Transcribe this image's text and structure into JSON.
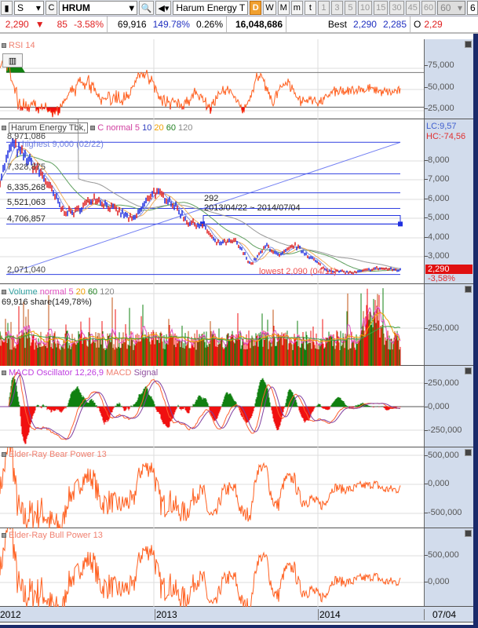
{
  "toolbar": {
    "type": "S",
    "c": "C",
    "symbol": "HRUM",
    "name": "Harum Energy T",
    "periods": [
      "D",
      "W",
      "M",
      "m",
      "t"
    ],
    "active_period": "D",
    "minutes": [
      "1",
      "3",
      "5",
      "10",
      "15",
      "30",
      "45",
      "60"
    ],
    "minute_select": "60",
    "extra": "6"
  },
  "quote": {
    "price": "2,290",
    "change": "85",
    "change_pct": "-3.58%",
    "volume": "69,916",
    "vol_ratio": "149.78%",
    "turnover": "0.26%",
    "amount": "16,048,686",
    "best_label": "Best",
    "bid": "2,290",
    "ask": "2,285",
    "open_label": "O",
    "open": "2,29"
  },
  "rsi": {
    "title": "RSI 14",
    "ticks": [
      "75,000",
      "50,000",
      "25,000"
    ]
  },
  "price": {
    "title": "Harum Energy Tbk,",
    "ma_label": "C normal 5",
    "ma": [
      "10",
      "20",
      "60",
      "120"
    ],
    "lc": "LC:9,57",
    "hc": "HC:-74,56",
    "highest": "highest 9,000 (02/22)",
    "lowest": "lowest 2,090 (04/11)",
    "levels": [
      "8,971,086",
      "7,328,875",
      "6,335,268",
      "5,521,063",
      "4,706,857",
      "2,071,040"
    ],
    "range_value": "292",
    "range_dates": "2013/04/22 ~ 2014/07/04",
    "ticks": [
      "8,000",
      "7,000",
      "6,000",
      "5,000",
      "4,000",
      "3,000"
    ],
    "last": "2,290",
    "last_pct": "-3,58%"
  },
  "volume": {
    "title": "Volume",
    "ma_label": "normal 5",
    "ma": [
      "20",
      "60",
      "120"
    ],
    "summary": "69,916 share(149,78%)",
    "ticks": [
      "250,000"
    ]
  },
  "macd": {
    "title": "MACD Oscillator 12,26,9",
    "macd": "MACD",
    "signal": "Signal",
    "ticks": [
      "250,000",
      "0,000",
      "-250,000"
    ]
  },
  "bear": {
    "title": "Elder-Ray Bear Power 13",
    "ticks": [
      "500,000",
      "0,000",
      "-500,000"
    ]
  },
  "bull": {
    "title": "Elder-Ray Bull Power 13",
    "ticks": [
      "500,000",
      "0,000"
    ]
  },
  "xaxis": {
    "labels": [
      "2012",
      "2013",
      "2014"
    ],
    "end": "07/04"
  },
  "chart_data": {
    "type": "line",
    "price_anchors": [
      [
        0,
        7000
      ],
      [
        15,
        8900
      ],
      [
        30,
        8300
      ],
      [
        55,
        7200
      ],
      [
        80,
        5400
      ],
      [
        95,
        5300
      ],
      [
        120,
        6100
      ],
      [
        140,
        5600
      ],
      [
        170,
        4900
      ],
      [
        195,
        6400
      ],
      [
        215,
        6000
      ],
      [
        240,
        4800
      ],
      [
        260,
        4600
      ],
      [
        275,
        3700
      ],
      [
        300,
        3800
      ],
      [
        320,
        2600
      ],
      [
        340,
        3600
      ],
      [
        355,
        3000
      ],
      [
        375,
        3600
      ],
      [
        395,
        3000
      ],
      [
        415,
        2300
      ],
      [
        450,
        2150
      ],
      [
        480,
        2400
      ],
      [
        510,
        2290
      ]
    ],
    "levels": [
      8971,
      7328,
      6335,
      5521,
      4706,
      2071
    ]
  }
}
